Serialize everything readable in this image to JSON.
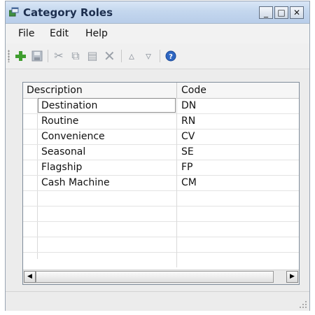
{
  "window": {
    "title": "Category Roles",
    "minimize_label": "_",
    "maximize_label": "□",
    "close_label": "✕"
  },
  "menu": {
    "file": "File",
    "edit": "Edit",
    "help": "Help"
  },
  "toolbar": {
    "icons": [
      "add-icon",
      "save-icon",
      "cut-icon",
      "copy-icon",
      "paste-icon",
      "delete-icon",
      "move-up-icon",
      "move-down-icon",
      "help-icon"
    ],
    "add_glyph": "+",
    "save_glyph": "▣",
    "cut_glyph": "✂",
    "copy_glyph": "⧉",
    "paste_glyph": "▤",
    "delete_glyph": "✕",
    "up_glyph": "▵",
    "down_glyph": "▿",
    "help_glyph": "?"
  },
  "grid": {
    "columns": [
      "Description",
      "Code"
    ],
    "rows": [
      {
        "description": "Destination",
        "code": "DN"
      },
      {
        "description": "Routine",
        "code": "RN"
      },
      {
        "description": "Convenience",
        "code": "CV"
      },
      {
        "description": "Seasonal",
        "code": "SE"
      },
      {
        "description": "Flagship",
        "code": "FP"
      },
      {
        "description": "Cash Machine",
        "code": "CM"
      }
    ],
    "scroll_left_glyph": "◀",
    "scroll_right_glyph": "▶"
  },
  "colors": {
    "accent_add": "#3f9e2f",
    "help_blue": "#2e66c2"
  }
}
